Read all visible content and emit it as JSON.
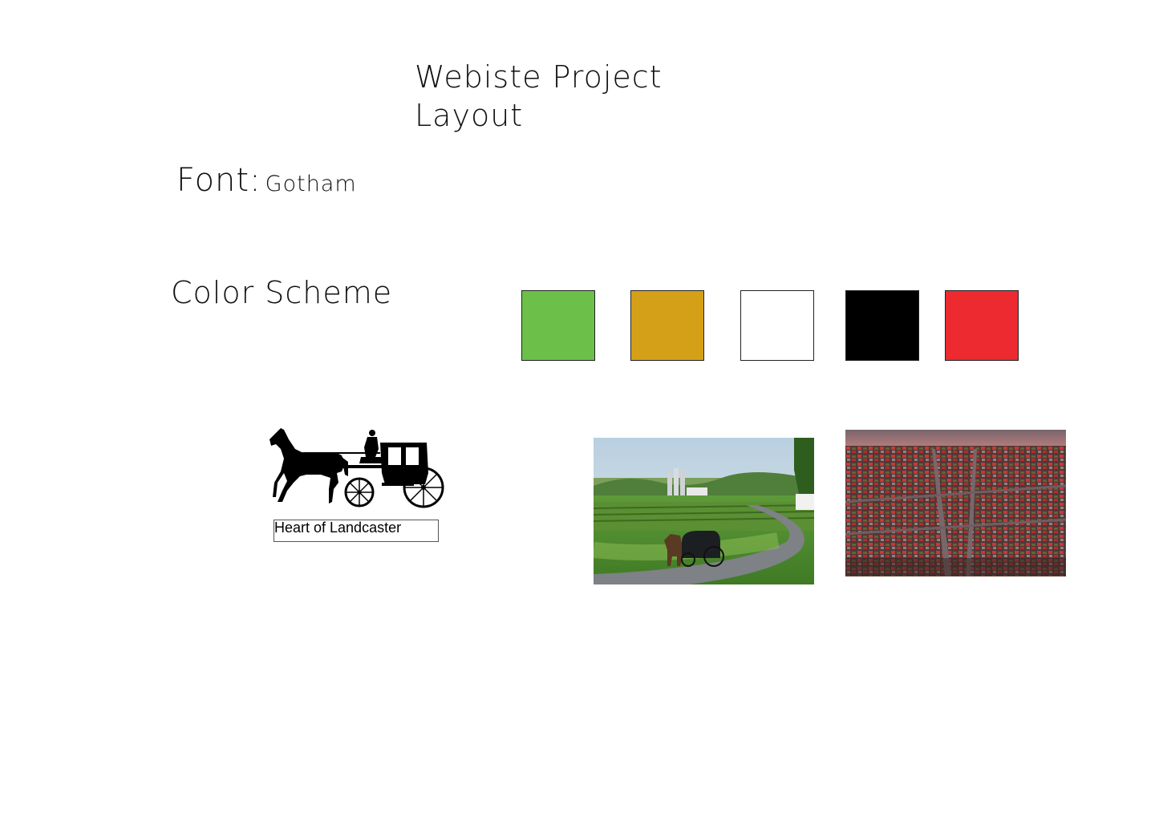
{
  "title": {
    "line1": "Webiste Project",
    "line2": "Layout"
  },
  "font_section": {
    "label": "Font:",
    "value": "Gotham"
  },
  "color_section": {
    "heading": "Color Scheme",
    "swatches": [
      "#6cc04a",
      "#d4a017",
      "#ffffff",
      "#000000",
      "#ec2a2f"
    ]
  },
  "logo": {
    "icon": "horse-and-buggy-icon",
    "caption": "Heart of Landcaster"
  },
  "photos": [
    {
      "name": "amish-buggy-farm-photo"
    },
    {
      "name": "lancaster-aerial-city-photo"
    }
  ]
}
